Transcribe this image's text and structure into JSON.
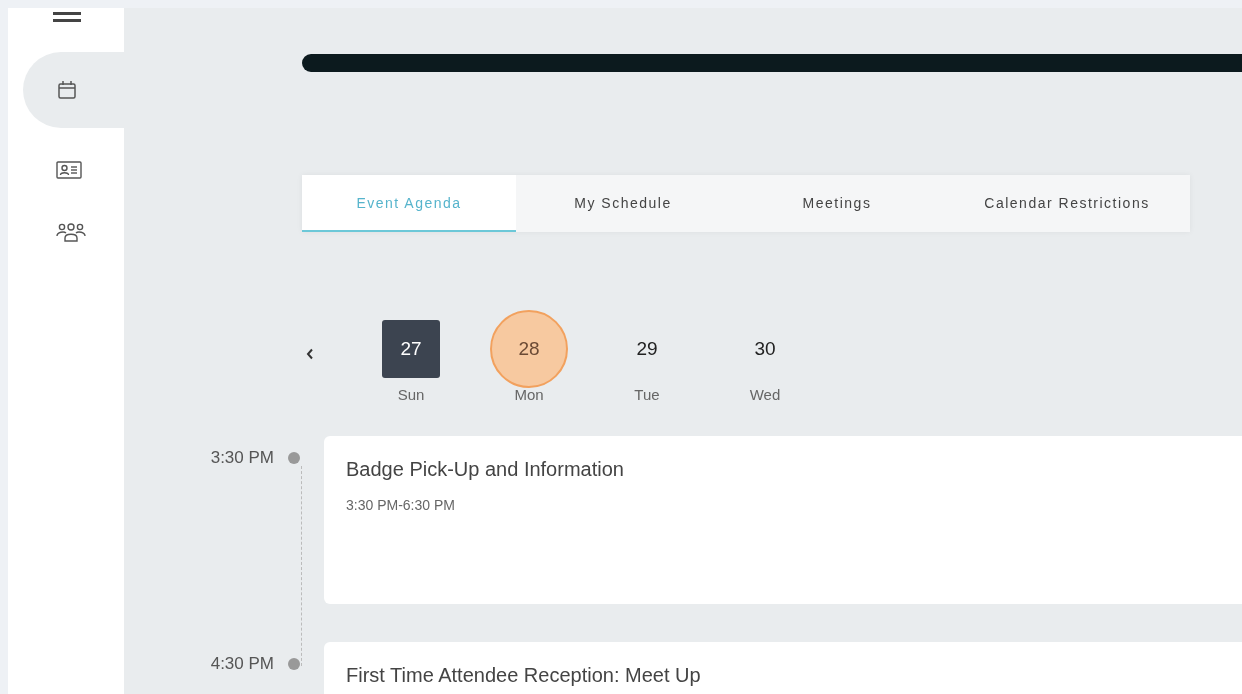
{
  "sidebar": {
    "items": [
      {
        "kind": "calendar",
        "selected": true
      },
      {
        "kind": "contact-card",
        "selected": false
      },
      {
        "kind": "people",
        "selected": false
      }
    ]
  },
  "tabs": [
    {
      "label": "Event Agenda",
      "selected": true
    },
    {
      "label": "My Schedule",
      "selected": false
    },
    {
      "label": "Meetings",
      "selected": false
    },
    {
      "label": "Calendar Restrictions",
      "selected": false
    }
  ],
  "days": [
    {
      "date": "27",
      "weekday": "Sun",
      "selected": true,
      "today": false
    },
    {
      "date": "28",
      "weekday": "Mon",
      "selected": false,
      "today": true
    },
    {
      "date": "29",
      "weekday": "Tue",
      "selected": false,
      "today": false
    },
    {
      "date": "30",
      "weekday": "Wed",
      "selected": false,
      "today": false
    }
  ],
  "events": [
    {
      "time": "3:30 PM",
      "title": "Badge Pick-Up and Information",
      "range": "3:30 PM-6:30 PM"
    },
    {
      "time": "4:30 PM",
      "title": "First Time Attendee Reception: Meet Up"
    }
  ]
}
